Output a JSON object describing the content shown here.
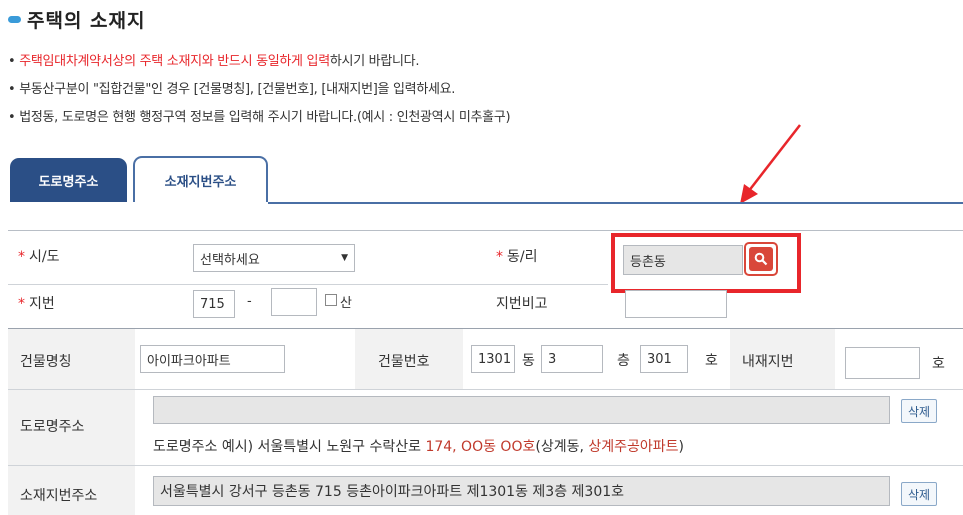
{
  "section_title": "주택의 소재지",
  "notices": {
    "line1_red": "주택임대차계약서상의 주택 소재지와 반드시 동일하게 입력",
    "line1_rest": "하시기 바랍니다.",
    "line2": "부동산구분이 \"집합건물\"인 경우 [건물명칭], [건물번호], [내재지번]을 입력하세요.",
    "line3": "법정동, 도로명은 현행 행정구역 정보를 입력해 주시기 바랍니다.(예시 : 인천광역시 미추홀구)"
  },
  "tabs": [
    "도로명주소",
    "소재지번주소"
  ],
  "form": {
    "sido_label": "시/도",
    "sido_value": "선택하세요",
    "dongri_label": "동/리",
    "dongri_value": "등촌동",
    "jibun_label": "지번",
    "jibun_main": "715",
    "jibun_dash": "-",
    "jibun_sub": "",
    "mountain_label": "산",
    "jibun_note_label": "지번비고",
    "jibun_note_value": ""
  },
  "building": {
    "name_label": "건물명칭",
    "name_value": "아이파크아파트",
    "number_label": "건물번호",
    "dong_value": "1301",
    "dong_unit": "동",
    "floor_value": "3",
    "floor_unit": "층",
    "ho_value": "301",
    "ho_unit": "호",
    "inner_label": "내재지번",
    "inner_value": "",
    "inner_unit": "호"
  },
  "road": {
    "label": "도로명주소",
    "value": "",
    "delete": "삭제",
    "example_prefix": "도로명주소 예시) 서울특별시 노원구 수락산로 ",
    "example_num": "174, OO동 OO호",
    "example_mid": "(상계동, ",
    "example_apt": "상계주공아파트",
    "example_end": ")"
  },
  "lot": {
    "label": "소재지번주소",
    "value": "서울특별시 강서구 등촌동  715 등촌아이파크아파트 제1301동 제3층 제301호",
    "delete": "삭제"
  },
  "colors": {
    "accent": "#2b4f86",
    "highlight": "#e8262b",
    "search_btn": "#d9473a"
  }
}
